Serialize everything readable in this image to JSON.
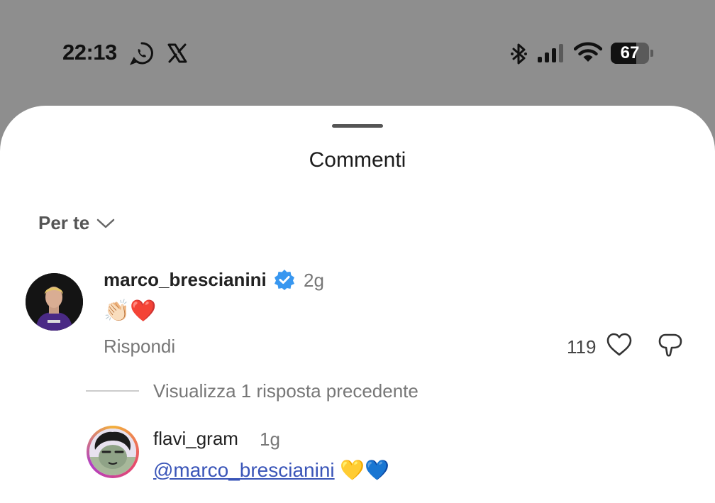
{
  "status_bar": {
    "time": "22:13",
    "battery_level": "67",
    "icons": [
      "whatsapp-icon",
      "x-icon",
      "bluetooth-icon",
      "signal-icon",
      "wifi-icon",
      "battery-icon"
    ]
  },
  "sheet": {
    "title": "Commenti",
    "sort_label": "Per te"
  },
  "comments": [
    {
      "username": "marco_brescianini",
      "verified": true,
      "age": "2g",
      "text": "👏🏻❤️",
      "reply_label": "Rispondi",
      "likes": "119"
    }
  ],
  "replies_link": "Visualizza 1 risposta precedente",
  "reply": {
    "username": "flavi_gram",
    "age": "1g",
    "mention": "@marco_brescianini",
    "emojis": "💛💙"
  },
  "colors": {
    "backdrop": "#8e8e8e",
    "sheet": "#ffffff",
    "verified": "#3897f0",
    "mention": "#3a55b8"
  }
}
